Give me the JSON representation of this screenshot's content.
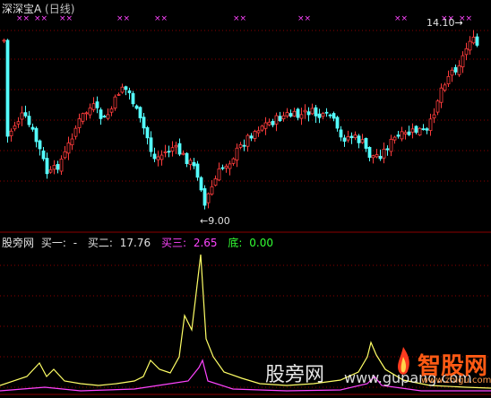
{
  "header": {
    "stock_name": "深深宝A",
    "period": "(日线)"
  },
  "price_panel": {
    "high_label": "14.10",
    "low_label": "9.00"
  },
  "indicator": {
    "name": "股旁网",
    "buy1_label": "买一:",
    "buy1_value": "-",
    "buy2_label": "买二:",
    "buy2_value": "17.76",
    "buy3_label": "买三:",
    "buy3_value": "2.65",
    "bottom_label": "底:",
    "bottom_value": "0.00"
  },
  "watermarks": {
    "site_name": "股旁网",
    "site_url": "www.gupang.com",
    "logo_text": "智股网",
    "logo_url": "www.zhigu.com"
  },
  "colors": {
    "up": "#ff3c3c",
    "down": "#54ffff",
    "yellow_line": "#ffff66",
    "magenta_line": "#ff44ff",
    "grid": "#8b0000",
    "signal": "#ff44ff"
  }
}
